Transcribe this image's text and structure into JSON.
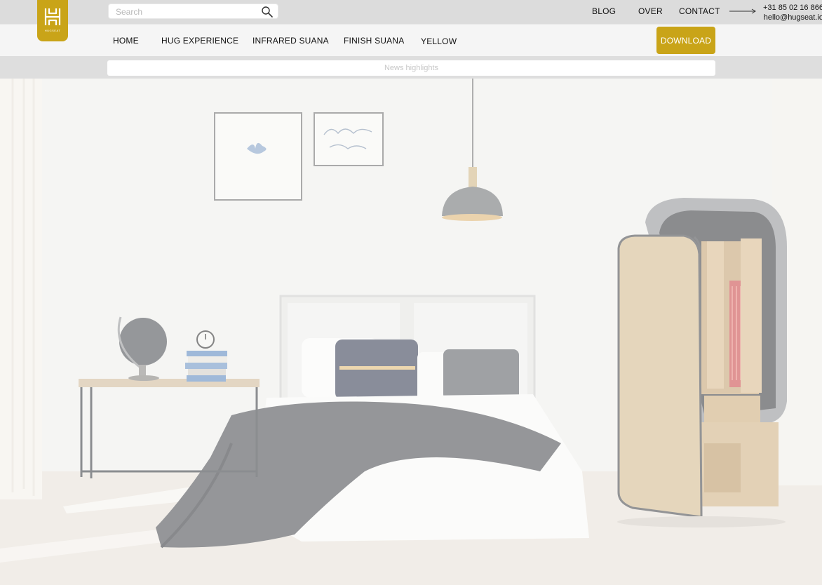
{
  "search": {
    "placeholder": "Search",
    "icon": "search-icon"
  },
  "top_links": [
    "BLOG",
    "OVER",
    "CONTACT"
  ],
  "contact": {
    "phone": "+31 85 02 16 866",
    "email": "hello@hugseat.io"
  },
  "logo": {
    "text": "HUGSEAT",
    "color": "#c9a418"
  },
  "nav": {
    "items": [
      "HOME",
      "HUG EXPERIENCE",
      "INFRARED SUANA",
      "FINISH SUANA",
      "YELLOW"
    ],
    "download_label": "DOWNLOAD"
  },
  "news": {
    "placeholder": "News highlights"
  },
  "colors": {
    "accent": "#c9a418",
    "topbar": "#dcdcdc",
    "nav": "#f5f5f5"
  }
}
